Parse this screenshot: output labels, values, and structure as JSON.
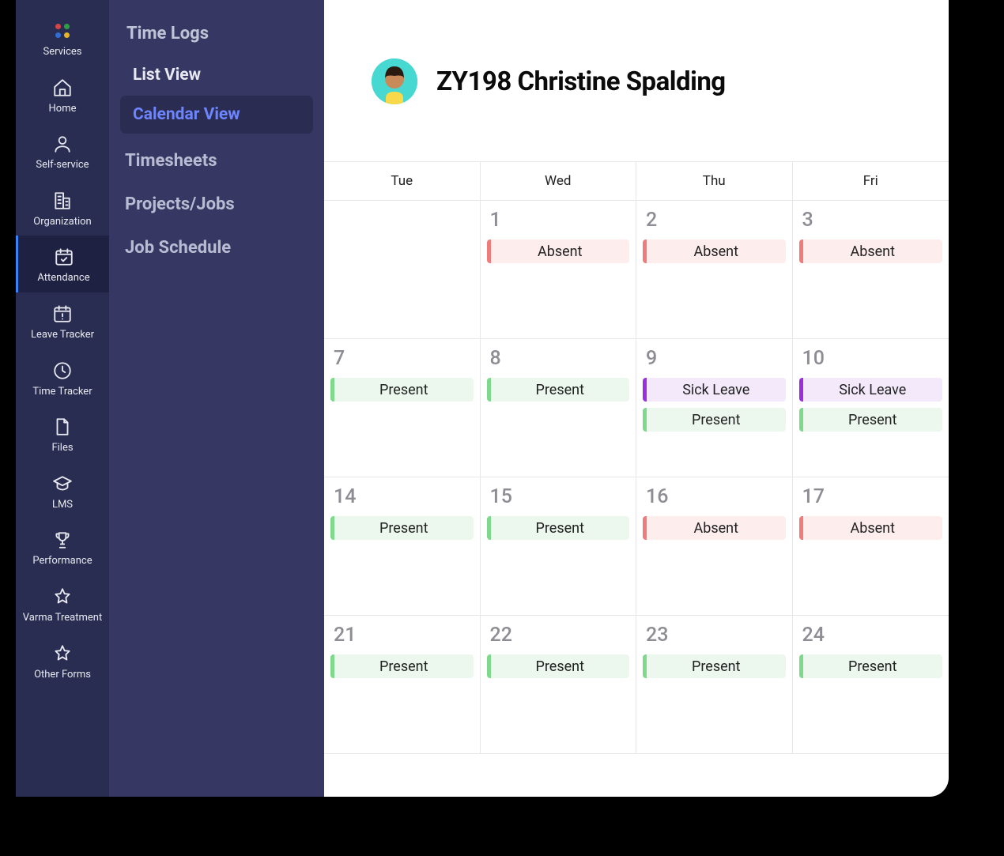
{
  "main_nav": [
    {
      "id": "services",
      "label": "Services",
      "icon": "services"
    },
    {
      "id": "home",
      "label": "Home",
      "icon": "home"
    },
    {
      "id": "selfservice",
      "label": "Self-service",
      "icon": "user"
    },
    {
      "id": "organization",
      "label": "Organization",
      "icon": "building"
    },
    {
      "id": "attendance",
      "label": "Attendance",
      "icon": "calendar-check",
      "active": true
    },
    {
      "id": "leave",
      "label": "Leave Tracker",
      "icon": "calendar-alert"
    },
    {
      "id": "time",
      "label": "Time Tracker",
      "icon": "clock"
    },
    {
      "id": "files",
      "label": "Files",
      "icon": "file"
    },
    {
      "id": "lms",
      "label": "LMS",
      "icon": "grad-cap"
    },
    {
      "id": "performance",
      "label": "Performance",
      "icon": "trophy"
    },
    {
      "id": "varma",
      "label": "Varma Treatment",
      "icon": "star"
    },
    {
      "id": "otherforms",
      "label": "Other Forms",
      "icon": "star"
    }
  ],
  "sub_nav": {
    "heading": "Time Logs",
    "items": [
      {
        "label": "List View",
        "selected": false
      },
      {
        "label": "Calendar View",
        "selected": true
      }
    ],
    "sections": [
      {
        "label": "Timesheets"
      },
      {
        "label": "Projects/Jobs"
      },
      {
        "label": "Job Schedule"
      }
    ]
  },
  "user": {
    "title": "ZY198 Christine Spalding"
  },
  "calendar": {
    "days": [
      "Tue",
      "Wed",
      "Thu",
      "Fri"
    ],
    "rows": [
      [
        {
          "date": "",
          "tags": []
        },
        {
          "date": "1",
          "tags": [
            {
              "type": "absent",
              "label": "Absent"
            }
          ]
        },
        {
          "date": "2",
          "tags": [
            {
              "type": "absent",
              "label": "Absent"
            }
          ]
        },
        {
          "date": "3",
          "tags": [
            {
              "type": "absent",
              "label": "Absent"
            }
          ]
        }
      ],
      [
        {
          "date": "7",
          "tags": [
            {
              "type": "present",
              "label": "Present"
            }
          ]
        },
        {
          "date": "8",
          "tags": [
            {
              "type": "present",
              "label": "Present"
            }
          ]
        },
        {
          "date": "9",
          "tags": [
            {
              "type": "sick",
              "label": "Sick Leave"
            },
            {
              "type": "present",
              "label": "Present"
            }
          ]
        },
        {
          "date": "10",
          "tags": [
            {
              "type": "sick",
              "label": "Sick Leave"
            },
            {
              "type": "present",
              "label": "Present"
            }
          ]
        }
      ],
      [
        {
          "date": "14",
          "tags": [
            {
              "type": "present",
              "label": "Present"
            }
          ]
        },
        {
          "date": "15",
          "tags": [
            {
              "type": "present",
              "label": "Present"
            }
          ]
        },
        {
          "date": "16",
          "tags": [
            {
              "type": "absent",
              "label": "Absent"
            }
          ]
        },
        {
          "date": "17",
          "tags": [
            {
              "type": "absent",
              "label": "Absent"
            }
          ]
        }
      ],
      [
        {
          "date": "21",
          "tags": [
            {
              "type": "present",
              "label": "Present"
            }
          ]
        },
        {
          "date": "22",
          "tags": [
            {
              "type": "present",
              "label": "Present"
            }
          ]
        },
        {
          "date": "23",
          "tags": [
            {
              "type": "present",
              "label": "Present"
            }
          ]
        },
        {
          "date": "24",
          "tags": [
            {
              "type": "present",
              "label": "Present"
            }
          ]
        }
      ]
    ]
  },
  "colors": {
    "services_dots": [
      "#d64545",
      "#2e9e44",
      "#2e6fd6",
      "#e4b429"
    ]
  }
}
